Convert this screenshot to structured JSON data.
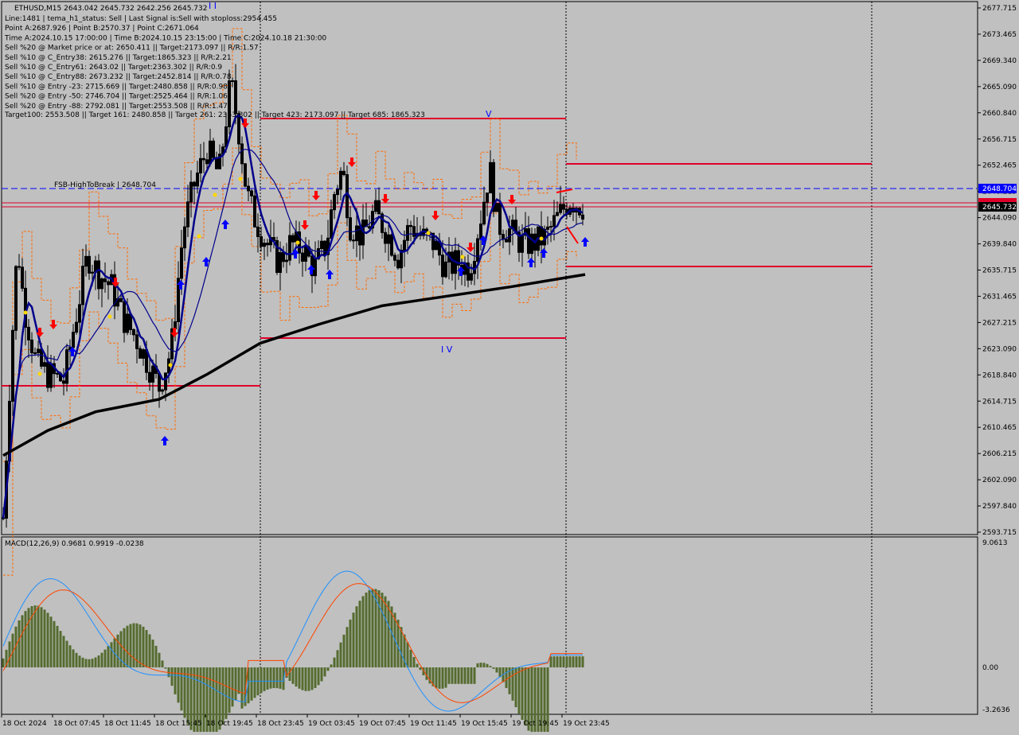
{
  "header": {
    "symbol_line": "ETHUSD,M15  2643.042 2645.732 2642.256 2645.732",
    "info_lines": [
      "Line:1481 | tema_h1_status: Sell | Last Signal is:Sell with stoploss:2954.455",
      "Point A:2687.926 | Point B:2570.37 | Point C:2671.064",
      "Time A:2024.10.15 17:00:00 | Time B:2024.10.15 23:15:00 | Time C:2024.10.18 21:30:00",
      "Sell %20 @ Market price or at: 2650.411 || Target:2173.097 || R/R:1.57",
      "Sell %10 @ C_Entry38: 2615.276 || Target:1865.323 || R/R:2.21",
      "Sell %10 @ C_Entry61: 2643.02 || Target:2363.302 || R/R:0.9",
      "Sell %10 @ C_Entry88: 2673.232 || Target:2452.814 || R/R:0.78",
      "Sell %10 @ Entry -23: 2715.669 || Target:2480.858 || R/R:0.98",
      "Sell %20 @ Entry -50: 2746.704 || Target:2525.464 || R/R:1.06",
      "Sell %20 @ Entry -88: 2792.081 || Target:2553.508 || R/R:1.47"
    ],
    "targets_line": "Target100: 2553.508 || Target 161: 2480.858 || Target 261: 2363.302 || Target 423: 2173.097 || Target 685: 1865.323"
  },
  "labels": {
    "fsb": "FSB-HighToBreak | 2648.704",
    "wave_ii": "I I",
    "wave_v": "V",
    "wave_iv": "I V"
  },
  "price_badges": {
    "fsb_price": "2648.704",
    "current_price": "2645.732"
  },
  "macd": {
    "title": "MACD(12,26,9) 0.9681 0.9919 -0.0238",
    "top_label": "9.0613",
    "zero_label": "0.00",
    "bottom_label": "-3.2636"
  },
  "colors": {
    "background": "#c0c0c0",
    "fsb_line": "#0000ff",
    "level_line": "#e0002a",
    "ma_fast": "#00008b",
    "ma_slow": "#000000",
    "channel": "#ff6a00",
    "histogram": "#556b2f",
    "macd_line": "#1e90ff",
    "signal_line": "#ff4500",
    "sell_arrow": "#ff0000",
    "buy_arrow": "#0000ff"
  },
  "chart_data": {
    "type": "candlestick",
    "price_axis": {
      "range": [
        2593.715,
        2677.715
      ],
      "ticks": [
        "2677.715",
        "2673.465",
        "2669.340",
        "2665.090",
        "2660.840",
        "2656.715",
        "2652.465",
        "2648.215",
        "2644.090",
        "2639.840",
        "2635.715",
        "2631.465",
        "2627.215",
        "2623.090",
        "2618.840",
        "2614.715",
        "2610.465",
        "2606.215",
        "2602.090",
        "2597.840",
        "2593.715"
      ]
    },
    "time_axis": {
      "ticks": [
        "18 Oct 2024",
        "18 Oct 07:45",
        "18 Oct 11:45",
        "18 Oct 15:45",
        "18 Oct 19:45",
        "18 Oct 23:45",
        "19 Oct 03:45",
        "19 Oct 07:45",
        "19 Oct 11:45",
        "19 Oct 15:45",
        "19 Oct 19:45",
        "19 Oct 23:45"
      ]
    },
    "levels": [
      {
        "name": "FSB-HighToBreak",
        "price": 2648.704
      },
      {
        "name": "current",
        "price": 2645.732
      }
    ],
    "macd": {
      "params": "12,26,9",
      "main": 0.9681,
      "signal": 0.9919,
      "histogram": -0.0238,
      "range": [
        -3.2636,
        9.0613
      ]
    }
  }
}
